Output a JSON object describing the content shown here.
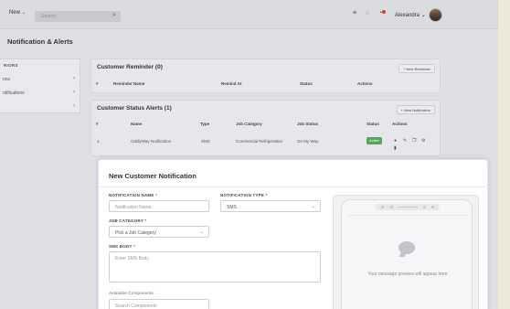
{
  "topbar": {
    "new_label": "New",
    "search_placeholder": "Search",
    "user_name": "Alexandra"
  },
  "page": {
    "title": "Notification & Alerts"
  },
  "sidebar": {
    "heading": "RIORS",
    "items": [
      {
        "label": "ons"
      },
      {
        "label": "otifications"
      },
      {
        "label": ""
      }
    ]
  },
  "customer_reminder": {
    "title": "Customer Reminder (0)",
    "add_label": "+ New Reminder",
    "columns": [
      "#",
      "Reminder Name",
      "Remind At",
      "Status",
      "Actions"
    ]
  },
  "customer_status_alerts": {
    "title": "Customer Status Alerts (1)",
    "add_label": "+ New Notification",
    "columns": [
      "#",
      "Name",
      "Type",
      "Job Category",
      "Job Status",
      "Status",
      "Actions"
    ],
    "rows": [
      {
        "num": "1",
        "name": "OddlyWay Notification",
        "type": "SMS",
        "job_category": "Commercial Refrigeration",
        "job_status": "On My Way",
        "status": "Active"
      }
    ]
  },
  "modal": {
    "title": "New Customer Notification",
    "notification_name": {
      "label": "NOTIFICATION NAME",
      "placeholder": "Notification Name"
    },
    "notification_type": {
      "label": "NOTIFICATION TYPE",
      "value": "SMS"
    },
    "job_category": {
      "label": "JOB CATEGORY",
      "value": "Pick a Job Category"
    },
    "sms_body": {
      "label": "SMS BODY",
      "placeholder": "Enter SMS Body"
    },
    "components": {
      "label": "Available Components :",
      "placeholder": "Search Components"
    },
    "preview_text": "Your message preview will appear here"
  },
  "colors": {
    "active_badge": "#56a65a",
    "notification_dot": "#d93b3b",
    "required_star": "#dd3333"
  }
}
